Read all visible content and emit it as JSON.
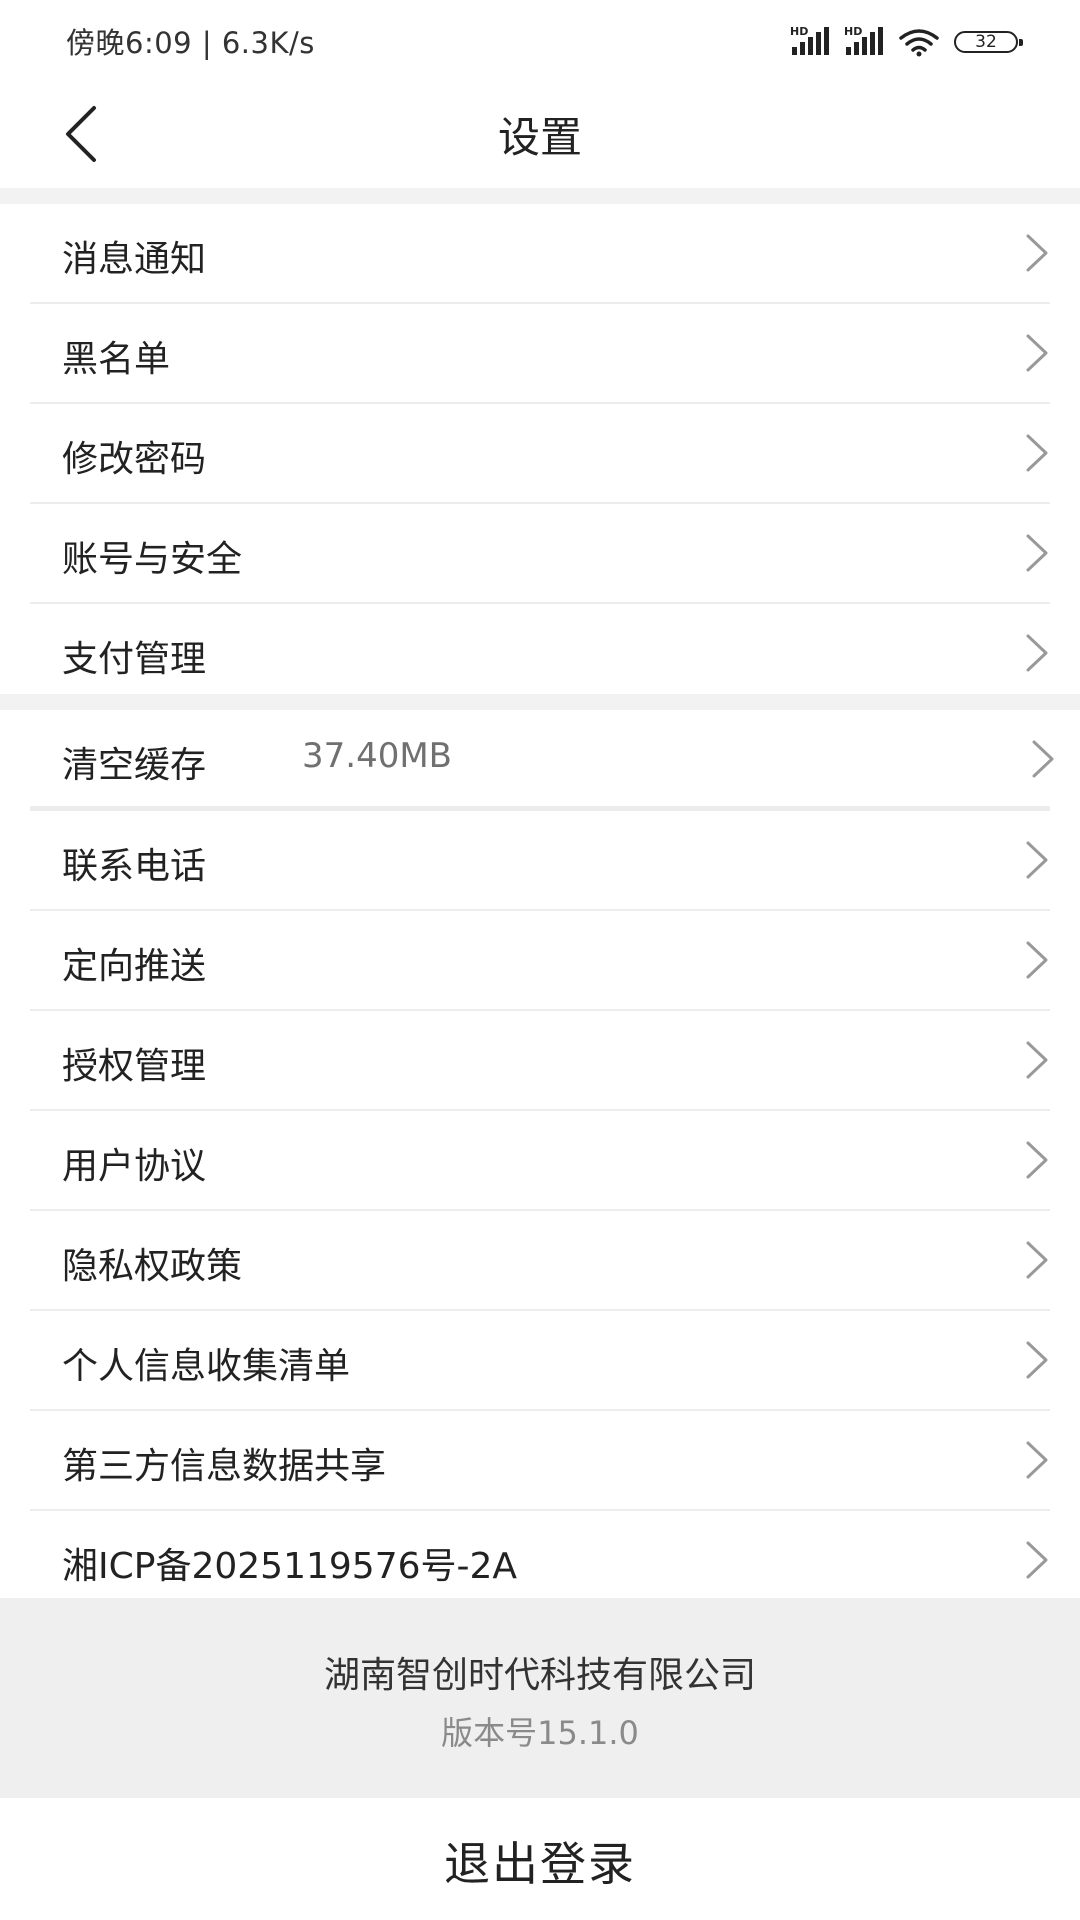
{
  "status_bar": {
    "time": "傍晚6:09 | 6.3K/s",
    "signal_label": "HD",
    "battery": "32"
  },
  "header": {
    "back_icon": "chevron-left-icon",
    "title": "设置"
  },
  "group1": {
    "items": [
      {
        "label": "消息通知"
      },
      {
        "label": "黑名单"
      },
      {
        "label": "修改密码"
      },
      {
        "label": "账号与安全"
      },
      {
        "label": "支付管理"
      }
    ]
  },
  "group2": {
    "cache": {
      "label": "清空缓存",
      "value": "37.40MB"
    },
    "items": [
      {
        "label": "联系电话"
      },
      {
        "label": "定向推送"
      },
      {
        "label": "授权管理"
      },
      {
        "label": "用户协议"
      },
      {
        "label": "隐私权政策"
      },
      {
        "label": "个人信息收集清单"
      },
      {
        "label": "第三方信息数据共享"
      },
      {
        "label": "湘ICP备2025119576号-2A"
      }
    ]
  },
  "footer": {
    "company": "湖南智创时代科技有限公司",
    "version": "版本号15.1.0"
  },
  "logout": {
    "label": "退出登录"
  },
  "colors": {
    "background": "#ffffff",
    "section_gap": "#f2f2f2",
    "footer_bg": "#efefef",
    "divider": "#ececec",
    "text_primary": "#222222",
    "text_secondary": "#8a8a8a",
    "chevron": "#999999"
  }
}
